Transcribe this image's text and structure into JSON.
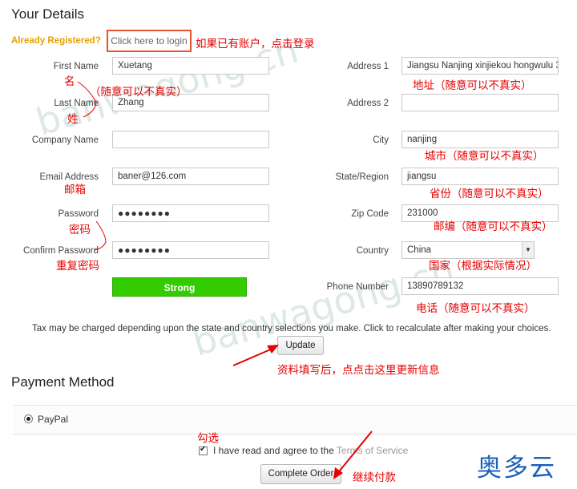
{
  "details": {
    "title": "Your Details",
    "already_registered": "Already Registered?",
    "login_link": "Click here to login",
    "login_note": "如果已有账户，点击登录",
    "left_fields": [
      {
        "label": "First Name",
        "value": "Xuetang"
      },
      {
        "label": "Last Name",
        "value": "Zhang"
      },
      {
        "label": "Company Name",
        "value": ""
      },
      {
        "label": "Email Address",
        "value": "baner@126.com"
      },
      {
        "label": "Password",
        "value": "●●●●●●●●"
      },
      {
        "label": "Confirm Password",
        "value": "●●●●●●●●"
      }
    ],
    "right_fields": [
      {
        "label": "Address 1",
        "value": "Jiangsu Nanjing xinjiekou hongwulu 34"
      },
      {
        "label": "Address 2",
        "value": ""
      },
      {
        "label": "City",
        "value": "nanjing"
      },
      {
        "label": "State/Region",
        "value": "jiangsu"
      },
      {
        "label": "Zip Code",
        "value": "231000"
      },
      {
        "label": "Country",
        "value": "China"
      },
      {
        "label": "Phone Number",
        "value": "13890789132"
      }
    ],
    "strength": "Strong",
    "tax_note": "Tax may be charged depending upon the state and country selections you make. Click to recalculate after making your choices.",
    "update_button": "Update"
  },
  "notes": {
    "ming": "名",
    "random1": "（随意可以不真实）",
    "xing": "姓",
    "email": "邮箱",
    "password": "密码",
    "repeat_password": "重复密码",
    "address": "地址（随意可以不真实）",
    "city": "城市（随意可以不真实）",
    "province": "省份（随意可以不真实）",
    "zip": "邮编（随意可以不真实）",
    "country": "国家（根据实际情况）",
    "phone": "电话（随意可以不真实）",
    "update": "资料填写后，点点击这里更新信息",
    "check": "勾选",
    "complete": "继续付款"
  },
  "payment": {
    "title": "Payment Method",
    "option": "PayPal",
    "agree_prefix": "I have read and agree to the ",
    "tos": "Terms of Service",
    "complete_button": "Complete Order"
  },
  "watermark": {
    "text1": "banwagong.cn",
    "text2": "banwagong.cn"
  },
  "logo": {
    "text": "奥多云"
  },
  "colors": {
    "green": "#33cc00",
    "red_note": "#e60000",
    "orange_link": "#e8a000",
    "highlight_box": "#e8542b"
  }
}
